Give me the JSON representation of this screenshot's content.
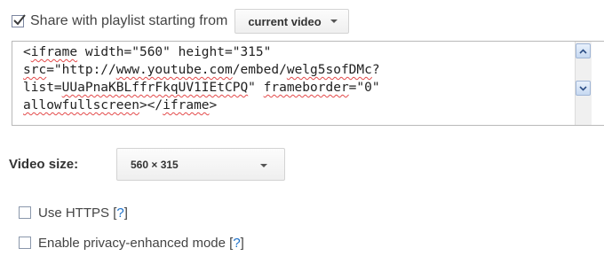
{
  "share": {
    "checked": true,
    "label": "Share with playlist starting from",
    "select_value": "current video"
  },
  "embed_code": {
    "text": "<iframe width=\"560\" height=\"315\" src=\"http://www.youtube.com/embed/welg5sofDMc?list=UUaPnaKBLffrFkqUV1IEtCPQ\" frameborder=\"0\" allowfullscreen></iframe>",
    "lines": [
      "<iframe width=\"560\" height=\"315\"",
      "src=\"http://www.youtube.com/embed/welg5sofDMc?",
      "list=UUaPnaKBLffrFkqUV1IEtCPQ\" frameborder=\"0\"",
      "allowfullscreen></iframe>"
    ]
  },
  "video_size": {
    "label": "Video size:",
    "value": "560 × 315"
  },
  "options": [
    {
      "checked": false,
      "label": "Use HTTPS",
      "help_open": "[",
      "help_link": "?",
      "help_close": "]"
    },
    {
      "checked": false,
      "label": "Enable privacy-enhanced mode",
      "help_open": "[",
      "help_link": "?",
      "help_close": "]"
    }
  ],
  "colors": {
    "link": "#1a6fc9",
    "spellcheck": "#e34a4a",
    "scroll_button": "#c7d9f1"
  },
  "icons": {
    "check": "checkmark-icon",
    "dropdown": "caret-down-icon",
    "scroll_up": "arrow-up-icon",
    "scroll_down": "arrow-down-icon"
  }
}
